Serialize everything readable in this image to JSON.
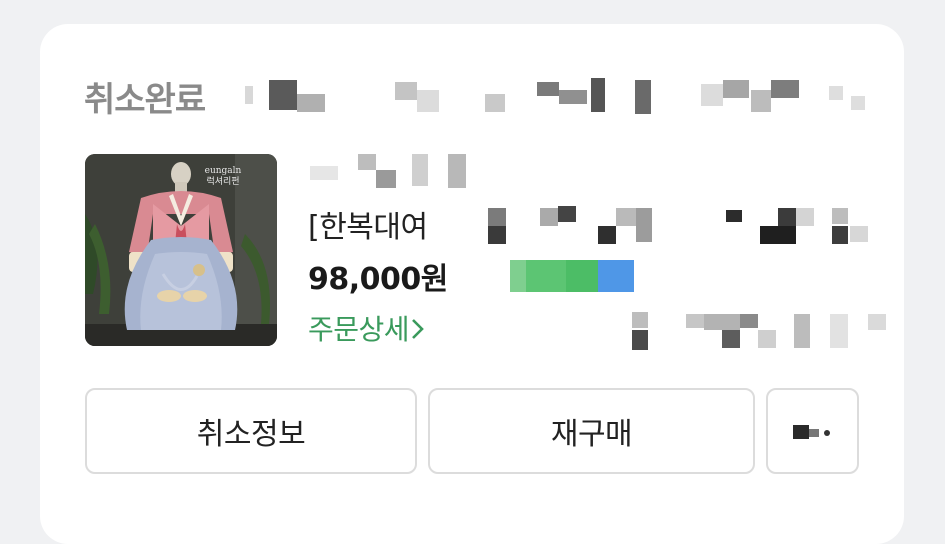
{
  "order": {
    "status": "취소완료",
    "product_name": "[한복대여",
    "price": "98,000원",
    "detail_link": "주문상세",
    "thumbnail_brand": "eungaln 럭셔리펀"
  },
  "actions": {
    "cancel_info": "취소정보",
    "rebuy": "재구매"
  },
  "icons": {
    "detail_chevron": "chevron-right-icon",
    "more": "more-icon"
  },
  "colors": {
    "accent_green": "#3a9a5c",
    "status_gray": "#8a8a8a"
  }
}
